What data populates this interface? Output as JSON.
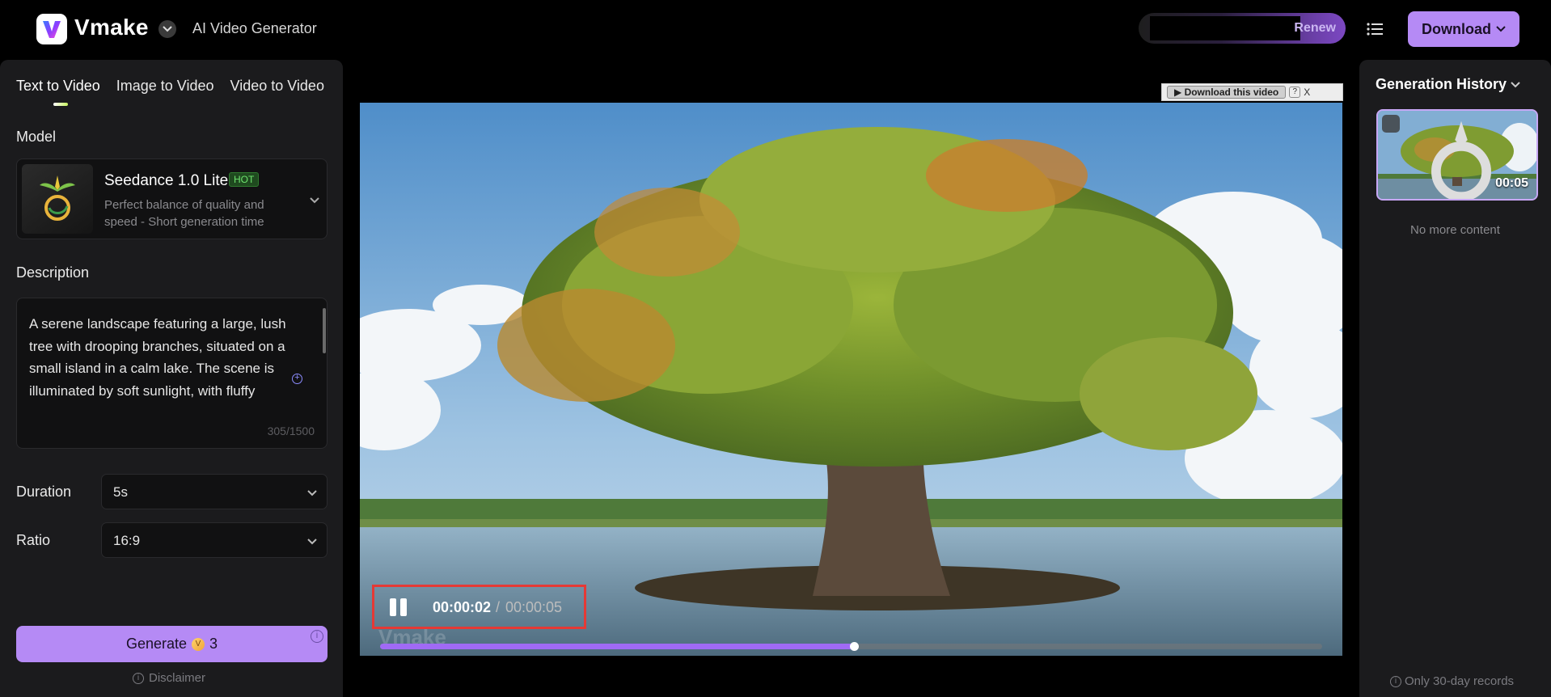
{
  "header": {
    "brand": "Vmake",
    "app_title": "AI Video Generator",
    "renew_label": "Renew",
    "download_label": "Download",
    "icons": [
      "vmake-logo-icon",
      "chevron-down-icon",
      "list-menu-icon"
    ]
  },
  "left_panel": {
    "tabs": [
      {
        "label": "Text to Video",
        "active": true
      },
      {
        "label": "Image to Video",
        "active": false
      },
      {
        "label": "Video to Video",
        "active": false
      }
    ],
    "model_label": "Model",
    "model": {
      "name": "Seedance 1.0 Lite",
      "badge": "HOT",
      "description": "Perfect balance of quality and speed - Short generation time"
    },
    "description_label": "Description",
    "description_text": "A serene landscape featuring a large, lush tree with drooping branches, situated on a small island in a calm lake. The scene is illuminated by soft sunlight, with fluffy",
    "char_count": "305/1500",
    "duration_label": "Duration",
    "duration_value": "5s",
    "ratio_label": "Ratio",
    "ratio_value": "16:9",
    "generate_label": "Generate",
    "generate_cost": "3",
    "disclaimer_label": "Disclaimer"
  },
  "player": {
    "download_video_label": "▶ Download this video",
    "help_label": "?",
    "close_label": "X",
    "current_time": "00:00:02",
    "separator": "/",
    "total_time": "00:00:05",
    "progress": 0.503,
    "watermark": "Vmake",
    "highlight_color": "#e53935"
  },
  "right_panel": {
    "title": "Generation History",
    "items": [
      {
        "duration": "00:05"
      }
    ],
    "no_more_label": "No more content",
    "records_note": "Only 30-day records"
  },
  "colors": {
    "accent": "#b58af5",
    "panel_bg": "#1b1b1d",
    "progress": "#a06af5"
  }
}
